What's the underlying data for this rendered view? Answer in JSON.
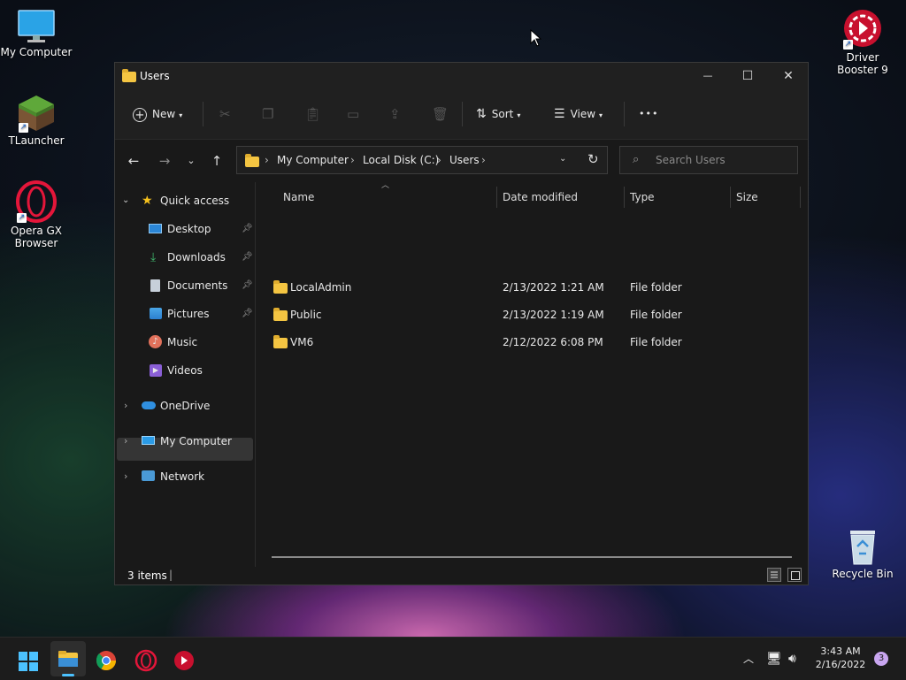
{
  "desktop": {
    "icons": [
      {
        "label": "My Computer",
        "icon": "monitor-icon"
      },
      {
        "label": "TLauncher",
        "icon": "minecraft-block-icon"
      },
      {
        "label": "Opera GX Browser",
        "icon": "opera-gx-icon"
      },
      {
        "label": "Driver Booster 9",
        "icon": "driver-booster-icon"
      },
      {
        "label": "Recycle Bin",
        "icon": "recycle-bin-icon"
      }
    ]
  },
  "window": {
    "title": "Users",
    "controls": {
      "minimize": "—",
      "maximize": "☐",
      "close": "✕"
    },
    "toolbar": {
      "new_label": "New",
      "sort_label": "Sort",
      "view_label": "View",
      "more_label": "•••"
    },
    "address": {
      "segments": [
        "My Computer",
        "Local Disk (C:)",
        "Users"
      ]
    },
    "search": {
      "placeholder": "Search Users"
    },
    "nav": {
      "quick_access": "Quick access",
      "items": [
        {
          "label": "Desktop",
          "pinned": true
        },
        {
          "label": "Downloads",
          "pinned": true
        },
        {
          "label": "Documents",
          "pinned": true
        },
        {
          "label": "Pictures",
          "pinned": true
        },
        {
          "label": "Music",
          "pinned": false
        },
        {
          "label": "Videos",
          "pinned": false
        }
      ],
      "onedrive": "OneDrive",
      "my_computer": "My Computer",
      "network": "Network"
    },
    "columns": {
      "name": "Name",
      "date": "Date modified",
      "type": "Type",
      "size": "Size"
    },
    "files": [
      {
        "name": "LocalAdmin",
        "date": "2/13/2022 1:21 AM",
        "type": "File folder",
        "size": ""
      },
      {
        "name": "Public",
        "date": "2/13/2022 1:19 AM",
        "type": "File folder",
        "size": ""
      },
      {
        "name": "VM6",
        "date": "2/12/2022 6:08 PM",
        "type": "File folder",
        "size": ""
      }
    ],
    "status": {
      "items": "3 items",
      "cursor": "|"
    }
  },
  "taskbar": {
    "apps": [
      "start-icon",
      "file-explorer-icon",
      "chrome-icon",
      "opera-gx-icon",
      "driver-booster-icon"
    ],
    "time": "3:43 AM",
    "date": "2/16/2022",
    "notification_count": "3"
  },
  "colors": {
    "accent": "#4cc2ff",
    "folder": "#f4c542",
    "window_bg": "#191919"
  }
}
